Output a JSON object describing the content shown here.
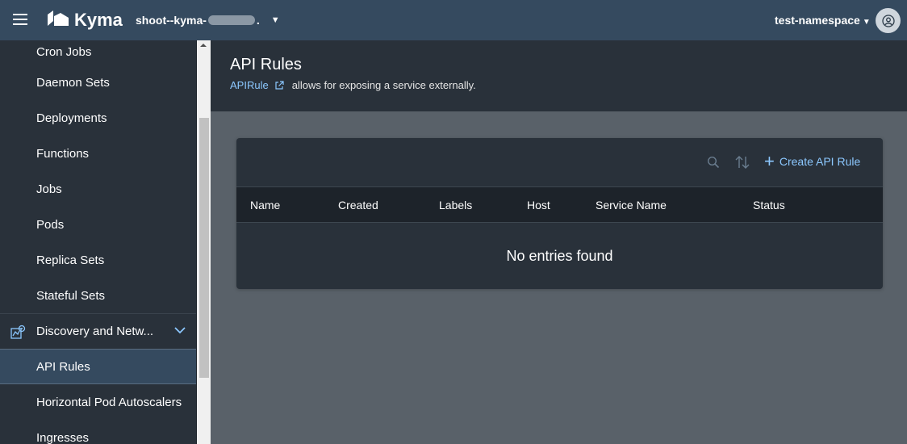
{
  "shellbar": {
    "product_name": "Kyma",
    "cluster_prefix": "shoot--kyma-",
    "cluster_suffix": ".",
    "namespace": "test-namespace"
  },
  "sidenav": {
    "items": [
      {
        "label": "Cron Jobs"
      },
      {
        "label": "Daemon Sets"
      },
      {
        "label": "Deployments"
      },
      {
        "label": "Functions"
      },
      {
        "label": "Jobs"
      },
      {
        "label": "Pods"
      },
      {
        "label": "Replica Sets"
      },
      {
        "label": "Stateful Sets"
      }
    ],
    "group": {
      "label": "Discovery and Netw..."
    },
    "group_items": [
      {
        "label": "API Rules"
      },
      {
        "label": "Horizontal Pod Autoscalers"
      },
      {
        "label": "Ingresses"
      }
    ]
  },
  "header": {
    "title": "API Rules",
    "link_text": "APIRule",
    "description": "allows for exposing a service externally."
  },
  "table": {
    "create_label": "Create API Rule",
    "columns": [
      "Name",
      "Created",
      "Labels",
      "Host",
      "Service Name",
      "Status"
    ],
    "empty_message": "No entries found"
  },
  "colors": {
    "shellbar": "#354a5f",
    "sidenav": "#29313a",
    "link": "#8cc8ff",
    "content_bg": "#596169"
  }
}
